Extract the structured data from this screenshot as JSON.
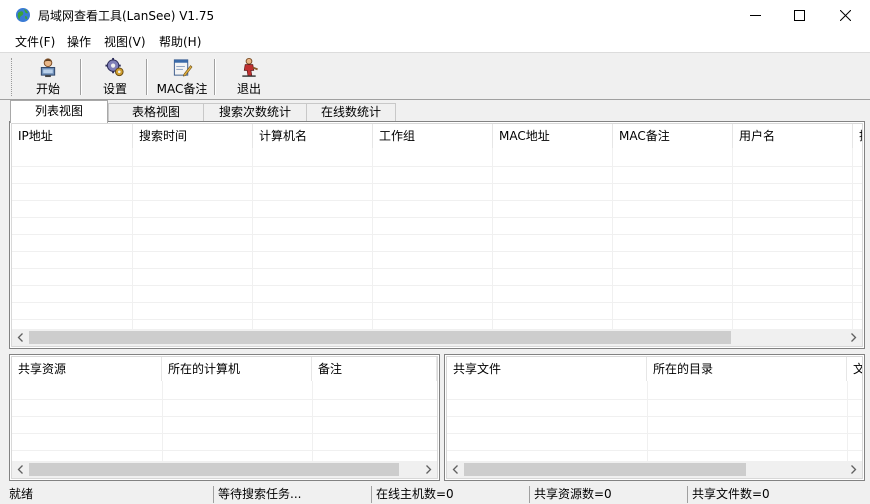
{
  "window": {
    "title": "局域网查看工具(LanSee) V1.75"
  },
  "menu": [
    "文件(F)",
    "操作",
    "视图(V)",
    "帮助(H)"
  ],
  "toolbar": {
    "start": "开始",
    "settings": "设置",
    "mac_note": "MAC备注",
    "exit": "退出"
  },
  "tabs": [
    "列表视图",
    "表格视图",
    "搜索次数统计",
    "在线数统计"
  ],
  "main_table": {
    "columns": [
      "IP地址",
      "搜索时间",
      "计算机名",
      "工作组",
      "MAC地址",
      "MAC备注",
      "用户名",
      "操"
    ]
  },
  "share_table": {
    "columns": [
      "共享资源",
      "所在的计算机",
      "备注"
    ]
  },
  "file_table": {
    "columns": [
      "共享文件",
      "所在的目录",
      "文"
    ]
  },
  "status": {
    "state": "就绪",
    "task": "等待搜索任务...",
    "online_hosts": "在线主机数=0",
    "shares": "共享资源数=0",
    "files": "共享文件数=0"
  },
  "icons": {
    "app": "globe-icon",
    "start": "computer-user-icon",
    "settings": "gear-icon",
    "mac_note": "note-edit-icon",
    "exit": "exit-person-icon"
  }
}
